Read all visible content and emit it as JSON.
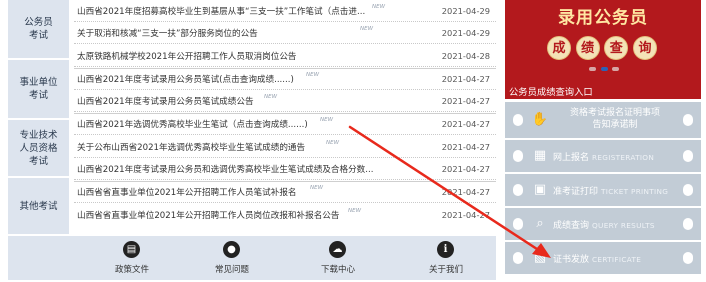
{
  "categories": [
    {
      "lines": [
        "公务员",
        "考试"
      ]
    },
    {
      "lines": [
        "事业单位",
        "考试"
      ]
    },
    {
      "lines": [
        "专业技术",
        "人员资格",
        "考试"
      ]
    },
    {
      "lines": [
        "其他考试"
      ]
    }
  ],
  "news": [
    {
      "title": "山西省2021年度招募高校毕业生到基层从事“三支一扶”工作笔试（点击进...",
      "new_badge": "NEW",
      "date": "2021-04-29"
    },
    {
      "title": "关于取消和核减“三支一扶”部分服务岗位的公告",
      "new_badge": "NEW",
      "date": "2021-04-29"
    },
    {
      "title": "太原铁路机械学校2021年公开招聘工作人员取消岗位公告",
      "new_badge": "",
      "date": "2021-04-28"
    },
    {
      "title": "山西省2021年度考试录用公务员笔试(点击查询成绩......)",
      "new_badge": "NEW",
      "date": "2021-04-27"
    },
    {
      "title": "山西省2021年度考试录用公务员笔试成绩公告",
      "new_badge": "NEW",
      "date": "2021-04-27"
    },
    {
      "title": "山西省2021年选调优秀高校毕业生笔试（点击查询成绩......)",
      "new_badge": "NEW",
      "date": "2021-04-27"
    },
    {
      "title": "关于公布山西省2021年选调优秀高校毕业生笔试成绩的通告",
      "new_badge": "NEW",
      "date": "2021-04-27"
    },
    {
      "title": "山西省2021年度考试录用公务员和选调优秀高校毕业生笔试成绩及合格分数...",
      "new_badge": "",
      "date": "2021-04-27"
    },
    {
      "title": "山西省省直事业单位2021年公开招聘工作人员笔试补报名",
      "new_badge": "NEW",
      "date": "2021-04-27"
    },
    {
      "title": "山西省省直事业单位2021年公开招聘工作人员岗位改报和补报名公告",
      "new_badge": "NEW",
      "date": "2021-04-27"
    }
  ],
  "toolbar": [
    {
      "label": "政策文件",
      "icon": "book-icon",
      "glyph": "▤"
    },
    {
      "label": "常见问题",
      "icon": "person-icon",
      "glyph": "●"
    },
    {
      "label": "下载中心",
      "icon": "cloud-download-icon",
      "glyph": "☁"
    },
    {
      "label": "关于我们",
      "icon": "info-icon",
      "glyph": "i"
    }
  ],
  "banner": {
    "title": "录用公务员",
    "chars": [
      "成",
      "绩",
      "查",
      "询"
    ],
    "caption": "公务员成绩查询入口",
    "background_color": "#b3191d"
  },
  "services": [
    {
      "lines": [
        "资格考试报名证明事项",
        "告知承诺制"
      ],
      "icon": "handshake-icon",
      "glyph": "✋"
    },
    {
      "label": "网上报名",
      "en": "REGISTERATION",
      "icon": "document-icon",
      "glyph": "▦"
    },
    {
      "label": "准考证打印",
      "en": "TICKET PRINTING",
      "icon": "printer-icon",
      "glyph": "▣"
    },
    {
      "label": "成绩查询",
      "en": "QUERY RESULTS",
      "icon": "magnifier-icon",
      "glyph": "⌕"
    },
    {
      "label": "证书发放",
      "en": "CERTIFICATE",
      "icon": "certificate-icon",
      "glyph": "▧"
    }
  ],
  "colors": {
    "arrow": "#e8291c",
    "panel": "#c2ccd6",
    "category_bg": "#dde4ee"
  }
}
